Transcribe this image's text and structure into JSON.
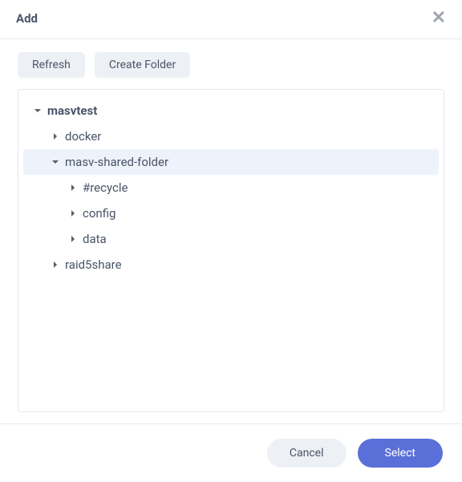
{
  "header": {
    "title": "Add"
  },
  "toolbar": {
    "refresh_label": "Refresh",
    "create_folder_label": "Create Folder"
  },
  "tree": {
    "root": {
      "label": "masvtest",
      "expanded": true,
      "children": [
        {
          "label": "docker",
          "expanded": false
        },
        {
          "label": "masv-shared-folder",
          "expanded": true,
          "selected": true,
          "children": [
            {
              "label": "#recycle",
              "expanded": false
            },
            {
              "label": "config",
              "expanded": false
            },
            {
              "label": "data",
              "expanded": false
            }
          ]
        },
        {
          "label": "raid5share",
          "expanded": false
        }
      ]
    }
  },
  "footer": {
    "cancel_label": "Cancel",
    "select_label": "Select"
  },
  "colors": {
    "primary": "#5a6fd8",
    "selected_bg": "#eef2fb",
    "text": "#4a5568",
    "border": "#e4e7ec"
  }
}
